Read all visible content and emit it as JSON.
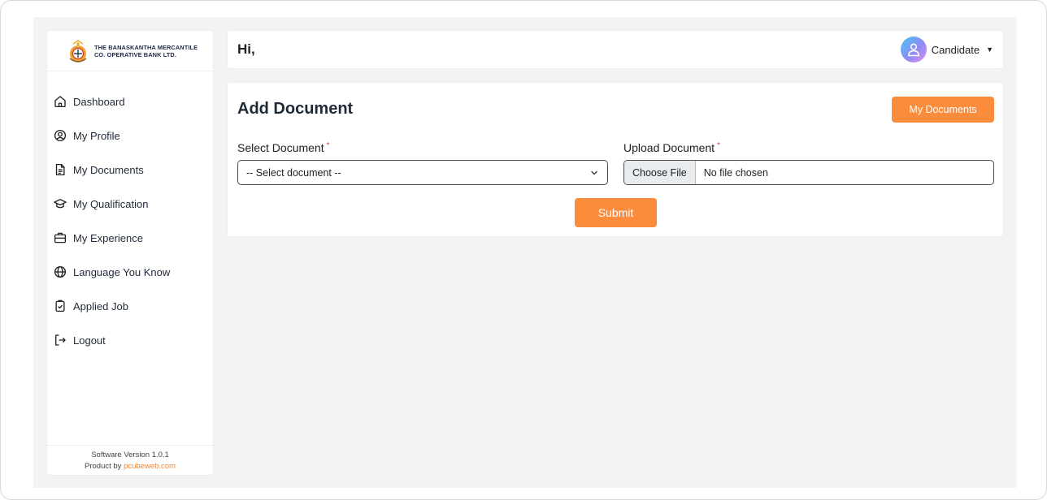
{
  "brand": {
    "line1": "THE BANASKANTHA MERCANTILE",
    "line2": "CO. OPERATIVE BANK LTD."
  },
  "sidebar": {
    "items": [
      {
        "label": "Dashboard",
        "icon": "home-icon"
      },
      {
        "label": "My Profile",
        "icon": "user-circle-icon"
      },
      {
        "label": "My Documents",
        "icon": "document-icon"
      },
      {
        "label": "My Qualification",
        "icon": "graduation-cap-icon"
      },
      {
        "label": "My Experience",
        "icon": "briefcase-icon"
      },
      {
        "label": "Language You Know",
        "icon": "globe-icon"
      },
      {
        "label": "Applied Job",
        "icon": "clipboard-check-icon"
      },
      {
        "label": "Logout",
        "icon": "logout-icon"
      }
    ],
    "footer": {
      "version": "Software Version 1.0.1",
      "product_prefix": "Product by",
      "product_link": "pcubeweb.com"
    }
  },
  "header": {
    "greeting": "Hi,",
    "user_name": "Candidate"
  },
  "card": {
    "title": "Add Document",
    "my_documents_button": "My Documents",
    "select_label": "Select Document",
    "select_value": "-- Select document --",
    "upload_label": "Upload Document",
    "required_mark": "*",
    "choose_file": "Choose File",
    "file_status": "No file chosen",
    "submit": "Submit"
  },
  "colors": {
    "accent": "#fb8c3c",
    "required": "#e0413e",
    "background": "#f2f3f5"
  }
}
